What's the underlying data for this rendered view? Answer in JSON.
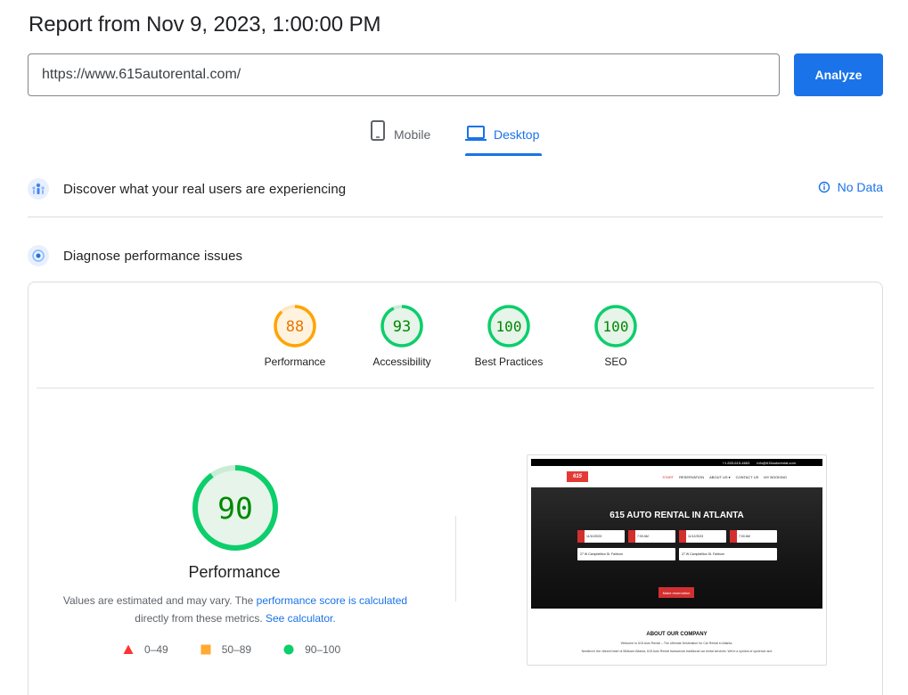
{
  "header": {
    "title": "Report from Nov 9, 2023, 1:00:00 PM"
  },
  "url_bar": {
    "value": "https://www.615autorental.com/",
    "analyze_label": "Analyze"
  },
  "tabs": [
    {
      "label": "Mobile",
      "active": false,
      "icon": "phone-icon"
    },
    {
      "label": "Desktop",
      "active": true,
      "icon": "laptop-icon"
    }
  ],
  "field_data": {
    "title": "Discover what your real users are experiencing",
    "status": "No Data",
    "status_icon": "info-icon"
  },
  "lab": {
    "title": "Diagnose performance issues"
  },
  "scores": [
    {
      "label": "Performance",
      "value": "88",
      "rating": "average"
    },
    {
      "label": "Accessibility",
      "value": "93",
      "rating": "pass"
    },
    {
      "label": "Best Practices",
      "value": "100",
      "rating": "pass"
    },
    {
      "label": "SEO",
      "value": "100",
      "rating": "pass"
    }
  ],
  "performance": {
    "score": "90",
    "title": "Performance",
    "desc_prefix": "Values are estimated and may vary. The ",
    "desc_link1": "performance score is calculated",
    "desc_middle": " directly from these metrics. ",
    "desc_link2": "See calculator."
  },
  "legend": [
    {
      "range": "0–49",
      "shape": "triangle",
      "color": "#ff3333"
    },
    {
      "range": "50–89",
      "shape": "square",
      "color": "#ffaa33"
    },
    {
      "range": "90–100",
      "shape": "circle",
      "color": "#0cce6b"
    }
  ],
  "screenshot": {
    "topbar_phone": "+1 833-615-4663",
    "topbar_email": "info@615autorental.com",
    "logo": "615",
    "nav": [
      "START",
      "RESERVATION",
      "ABOUT US ▾",
      "CONTACT US",
      "MY BOOKING"
    ],
    "hero_title": "615 AUTO RENTAL IN ATLANTA",
    "pickup_date": "11/10/2023",
    "pickup_time": "7:00 AM",
    "return_date": "11/12/2023",
    "return_time": "7:00 AM",
    "pickup_location": "27 W Campbellton St. Fairburn",
    "return_location": "27 W Campbellton St. Fairburn",
    "cta": "Make reservation",
    "about_title": "ABOUT OUR COMPANY",
    "about_line1": "Welcome to 615 Auto Rental – The Ultimate Destination for Car Rental in Atlanta.",
    "about_line2": "Nestled in the vibrant heart of Midtown Atlanta, 615 Auto Rental transcends traditional car rental services. We're a symbol of opulence and"
  },
  "colors": {
    "accent": "#1a73e8",
    "pass": "#0cce6b",
    "average": "#ffa400",
    "fail": "#ff4e42"
  }
}
